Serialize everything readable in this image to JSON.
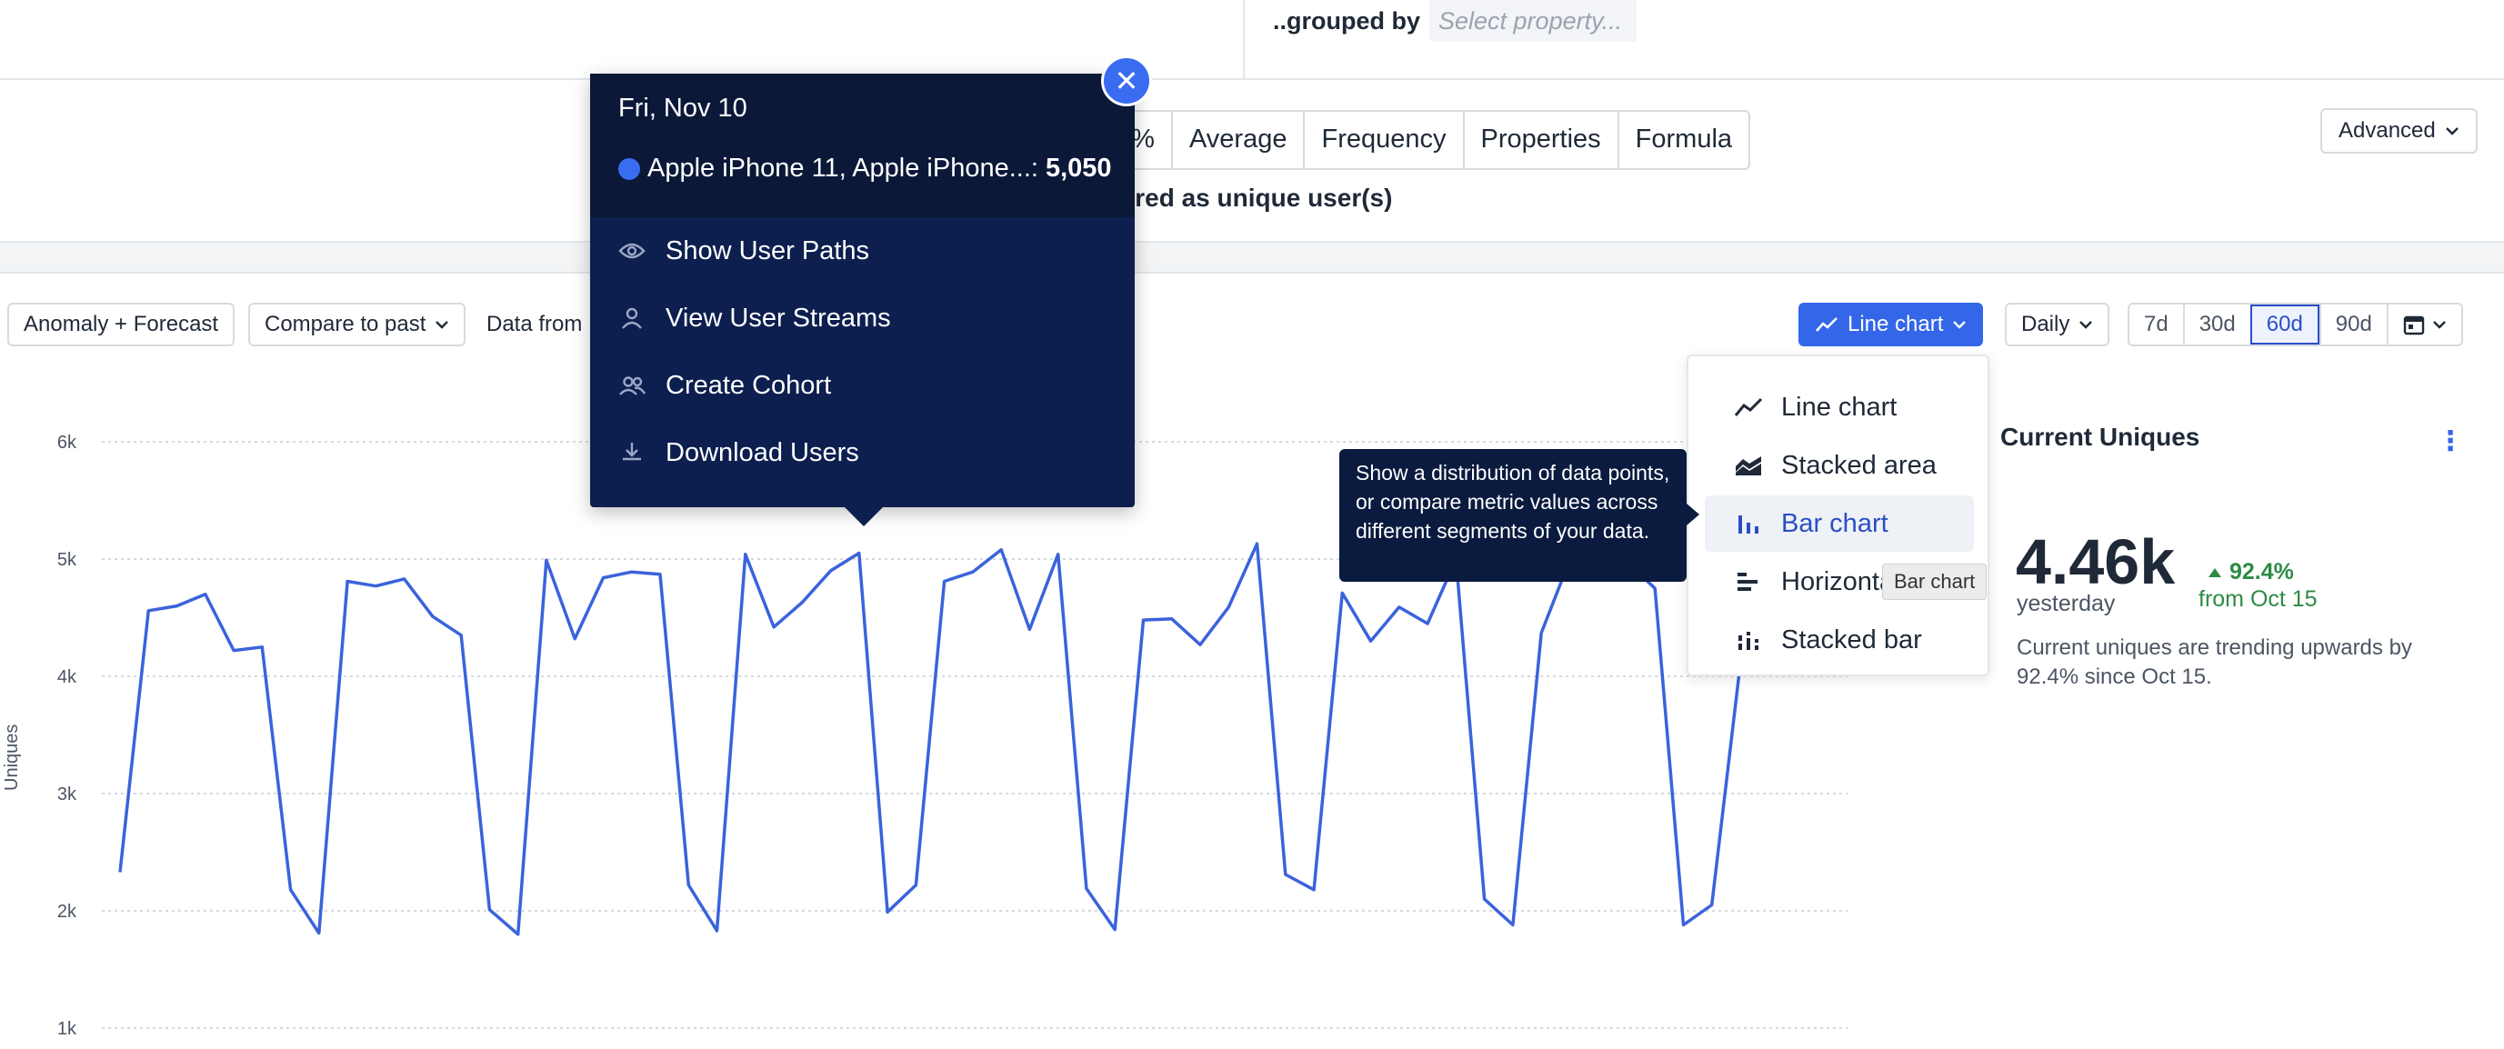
{
  "header": {
    "grouped_by_label": "..grouped by",
    "grouped_by_placeholder": "Select property..."
  },
  "metric_toolbar": {
    "tabs": [
      "e %",
      "Average",
      "Frequency",
      "Properties",
      "Formula"
    ],
    "measured_as": "asured as unique user(s)",
    "advanced_label": "Advanced"
  },
  "chart_toolbar": {
    "anomaly_label": "Anomaly + Forecast",
    "compare_label": "Compare to past",
    "data_from_label": "Data from",
    "chart_type_label": "Line chart",
    "interval_label": "Daily",
    "ranges": [
      "7d",
      "30d",
      "60d",
      "90d"
    ],
    "active_range": "60d"
  },
  "chart_type_menu": {
    "items": [
      {
        "label": "Line chart",
        "icon": "line-chart-icon"
      },
      {
        "label": "Stacked area",
        "icon": "stacked-area-icon"
      },
      {
        "label": "Bar chart",
        "icon": "bar-chart-icon"
      },
      {
        "label": "Horizontal",
        "icon": "horizontal-bar-icon"
      },
      {
        "label": "Stacked bar",
        "icon": "stacked-bar-icon"
      }
    ],
    "hovered": "Bar chart",
    "hover_tooltip": "Bar chart",
    "description": "Show a distribution of data points, or compare metric values across different segments of your data."
  },
  "current_uniques": {
    "title": "Current Uniques",
    "value": "4.46k",
    "period": "yesterday",
    "change": "92.4%",
    "change_from": "from Oct 15",
    "description": "Current uniques are trending upwards by 92.4% since Oct 15."
  },
  "popover": {
    "date": "Fri, Nov 10",
    "series_label": "Apple iPhone 11, Apple iPhone...:",
    "series_value": "5,050",
    "actions": [
      {
        "label": "Show User Paths",
        "icon": "eye-icon"
      },
      {
        "label": "View User Streams",
        "icon": "user-icon"
      },
      {
        "label": "Create Cohort",
        "icon": "users-icon"
      },
      {
        "label": "Download Users",
        "icon": "download-icon"
      }
    ]
  },
  "colors": {
    "accent": "#3366e8",
    "series": "#3a63dc",
    "positive": "#2e8b45",
    "popover_bg": "#0d1f4f"
  },
  "chart_data": {
    "type": "line",
    "ylabel": "Uniques",
    "yticks": [
      "1k",
      "2k",
      "3k",
      "4k",
      "5k",
      "6k"
    ],
    "ylim": [
      1000,
      6000
    ],
    "grid": true,
    "series": [
      {
        "values": [
          2330,
          4560,
          4600,
          4700,
          4220,
          4250,
          2180,
          1810,
          4810,
          4770,
          4830,
          4510,
          4350,
          2010,
          1800,
          4990,
          4320,
          4840,
          4890,
          4870,
          2220,
          1830,
          5040,
          4420,
          4630,
          4900,
          5050,
          1990,
          2220,
          4810,
          4890,
          5080,
          4400,
          5040,
          2190,
          1840,
          4480,
          4490,
          4270,
          4590,
          5130,
          2310,
          2180,
          4710,
          4300,
          4590,
          4450,
          5000,
          2100,
          1880,
          4370,
          4990,
          5030,
          4980,
          4750,
          1880,
          2050,
          4100
        ]
      }
    ]
  }
}
